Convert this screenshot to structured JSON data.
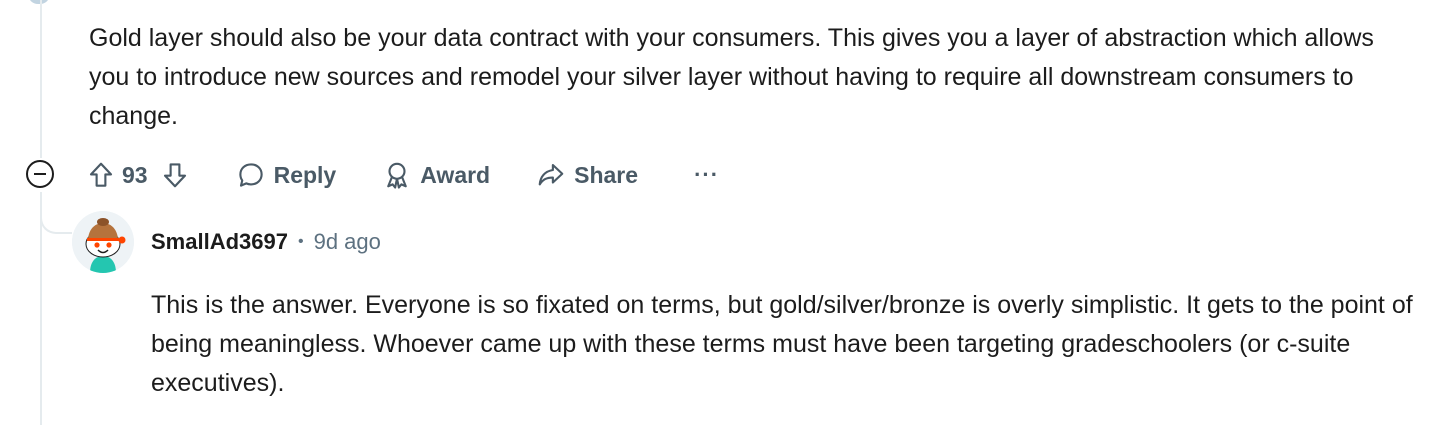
{
  "parent_comment": {
    "body": "Gold layer should also be your data contract with your consumers. This gives you a layer of abstraction which allows you to introduce new sources and remodel your silver layer without having to require all downstream consumers to change.",
    "votes": "93",
    "actions": {
      "reply": "Reply",
      "award": "Award",
      "share": "Share",
      "more": "···"
    }
  },
  "reply_comment": {
    "username": "SmallAd3697",
    "separator": "•",
    "timestamp": "9d ago",
    "body": "This is the answer. Everyone is so fixated on terms, but gold/silver/bronze is overly simplistic. It gets to the point of being meaningless. Whoever came up with these terms must have been targeting gradeschoolers (or c-suite executives)."
  },
  "icons": {
    "collapse": "collapse-minus-icon",
    "upvote": "upvote-arrow-icon",
    "downvote": "downvote-arrow-icon",
    "reply": "speech-bubble-icon",
    "award": "award-ribbon-icon",
    "share": "share-arrow-icon",
    "more": "ellipsis-icon"
  },
  "colors": {
    "text": "#1c1c1c",
    "meta": "#5d7180",
    "action": "#4a5a66",
    "thread_line": "#e5ebee",
    "avatar_orange": "#ff4500"
  }
}
